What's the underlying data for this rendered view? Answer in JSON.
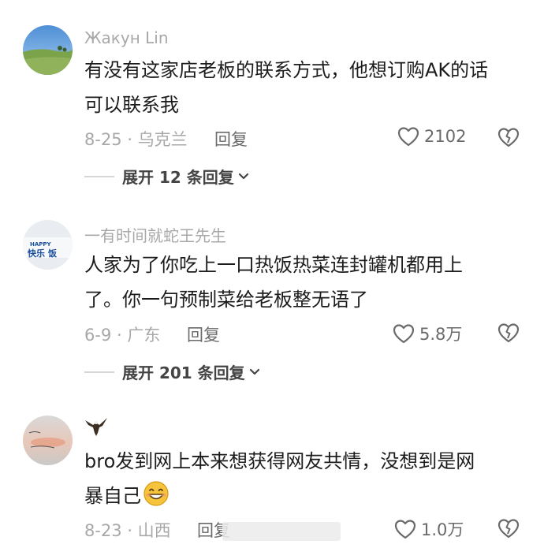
{
  "comments": [
    {
      "username": "Жакун Lin",
      "text_lines": [
        "有没有这家店老板的联系方式，他想订购AK的话",
        "可以联系我"
      ],
      "date_location": "8-25 · 乌克兰",
      "reply_label": "回复",
      "likes": "2102",
      "expand_label": "展开 12 条回复",
      "avatar_icon": "landscape-avatar"
    },
    {
      "username": "一有时间就蛇王先生",
      "text_lines": [
        "人家为了你吃上一口热饭热菜连封罐机都用上",
        "了。你一句预制菜给老板整无语了"
      ],
      "date_location": "6-9 · 广东",
      "reply_label": "回复",
      "likes": "5.8万",
      "expand_label": "展开 201 条回复",
      "avatar_icon": "happy-meal-avatar",
      "avatar_text": [
        "HAPPY",
        "快乐",
        "饭"
      ]
    },
    {
      "username": "",
      "username_icon": "eagle-icon",
      "text_lines": [
        "bro发到网上本来想获得网友共情，没想到是网",
        "暴自己"
      ],
      "emoji": "grin-emoji",
      "date_location": "8-23 · 山西",
      "reply_label": "回复",
      "likes": "1.0万",
      "avatar_icon": "sunset-avatar"
    }
  ],
  "colors": {
    "primary_text": "#1c1c1c",
    "secondary_text": "#a8a8a8",
    "action_text": "#6a6a6a"
  }
}
